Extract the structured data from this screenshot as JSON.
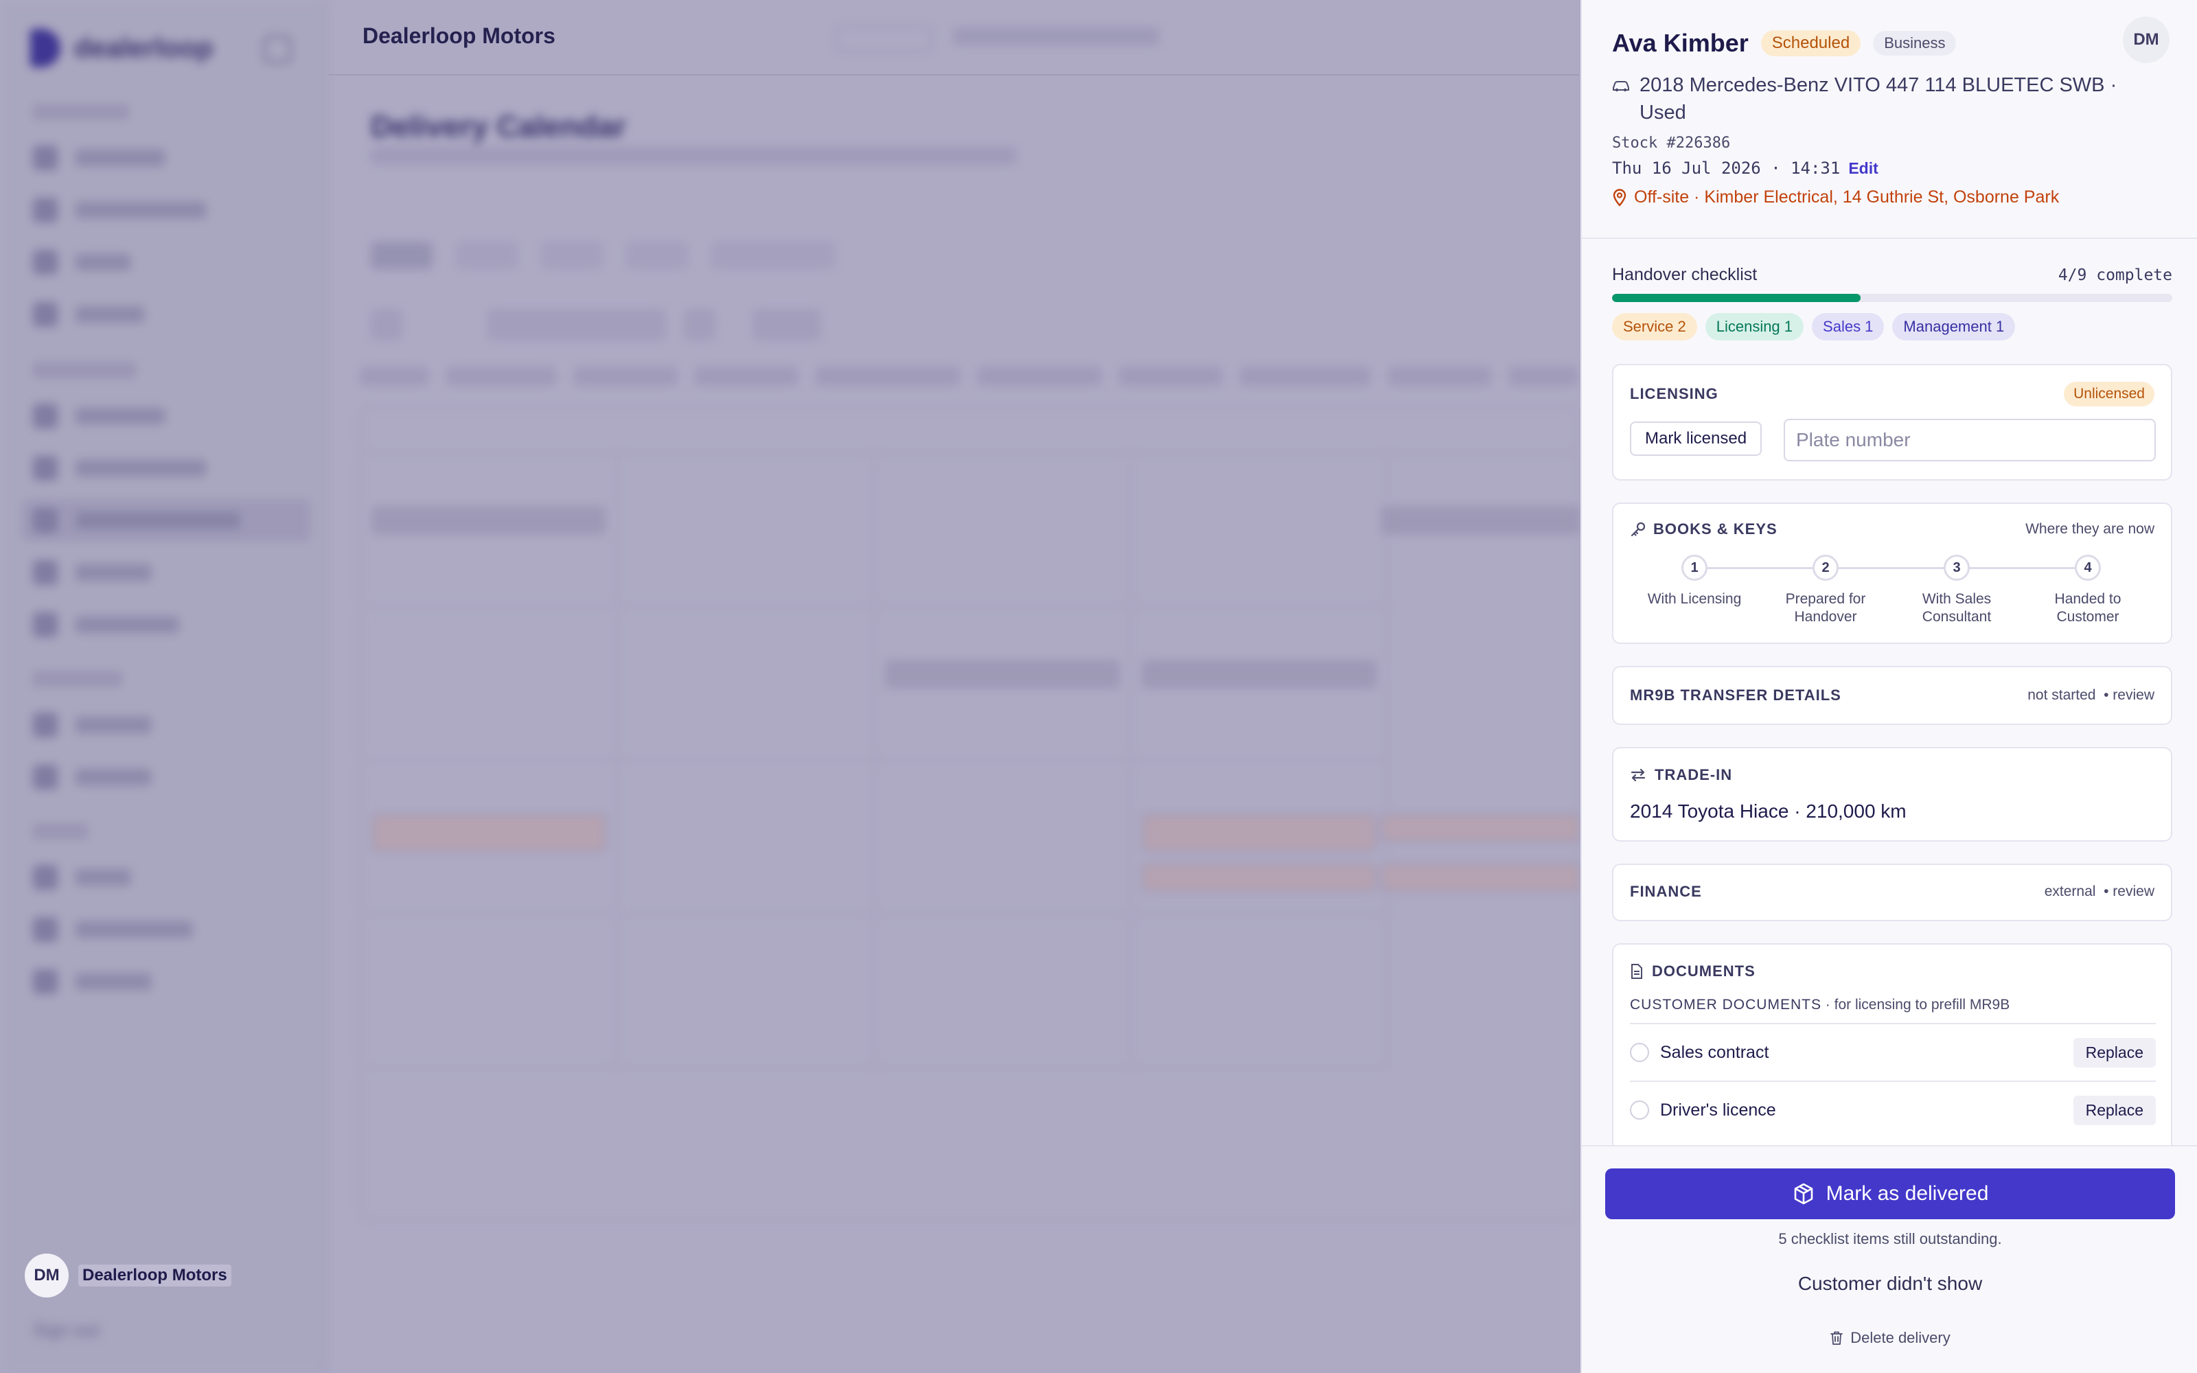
{
  "background": {
    "brand": "dealerloop",
    "business_name": "Dealerloop Motors",
    "page_title": "Delivery Calendar",
    "user_initials": "DM",
    "user_name": "Dealerloop Motors",
    "sign_out": "Sign out"
  },
  "drawer": {
    "customer_name": "Ava Kimber",
    "status": "Scheduled",
    "customer_type": "Business",
    "avatar_initials": "DM",
    "vehicle": "2018 Mercedes-Benz VITO 447 114 BLUETEC SWB · Used",
    "stock": "Stock #226386",
    "datetime": "Thu 16 Jul 2026 · 14:31",
    "edit_label": "Edit",
    "location": "Off-site · Kimber Electrical, 14 Guthrie St, Osborne Park",
    "checklist": {
      "label": "Handover checklist",
      "count": "4/9 complete",
      "progress_fraction": 0.444,
      "tags": [
        {
          "label": "Service 2",
          "tone": "orange"
        },
        {
          "label": "Licensing 1",
          "tone": "green"
        },
        {
          "label": "Sales 1",
          "tone": "violet"
        },
        {
          "label": "Management 1",
          "tone": "indigo"
        }
      ]
    },
    "licensing": {
      "title": "Licensing",
      "badge": "Unlicensed",
      "button": "Mark licensed",
      "plate_placeholder": "Plate number"
    },
    "books_keys": {
      "title": "Books & Keys",
      "hint": "Where they are now",
      "steps": [
        {
          "num": "1",
          "label": "With Licensing"
        },
        {
          "num": "2",
          "label": "Prepared for Handover"
        },
        {
          "num": "3",
          "label": "With Sales Consultant"
        },
        {
          "num": "4",
          "label": "Handed to Customer"
        }
      ]
    },
    "mr9b": {
      "title": "MR9B Transfer Details",
      "status": "not started",
      "action": "• review"
    },
    "trade_in": {
      "title": "Trade-in",
      "value": "2014 Toyota Hiace · 210,000 km"
    },
    "finance": {
      "title": "Finance",
      "status": "external",
      "action": "• review"
    },
    "documents": {
      "title": "Documents",
      "sub_label": "Customer documents",
      "sub_text": " · for licensing to prefill MR9B",
      "items": [
        {
          "label": "Sales contract",
          "action": "Replace"
        },
        {
          "label": "Driver's licence",
          "action": "Replace"
        }
      ]
    },
    "footer": {
      "primary": "Mark as delivered",
      "note": "5 checklist items still outstanding.",
      "no_show": "Customer didn't show",
      "delete": "Delete delivery"
    }
  }
}
